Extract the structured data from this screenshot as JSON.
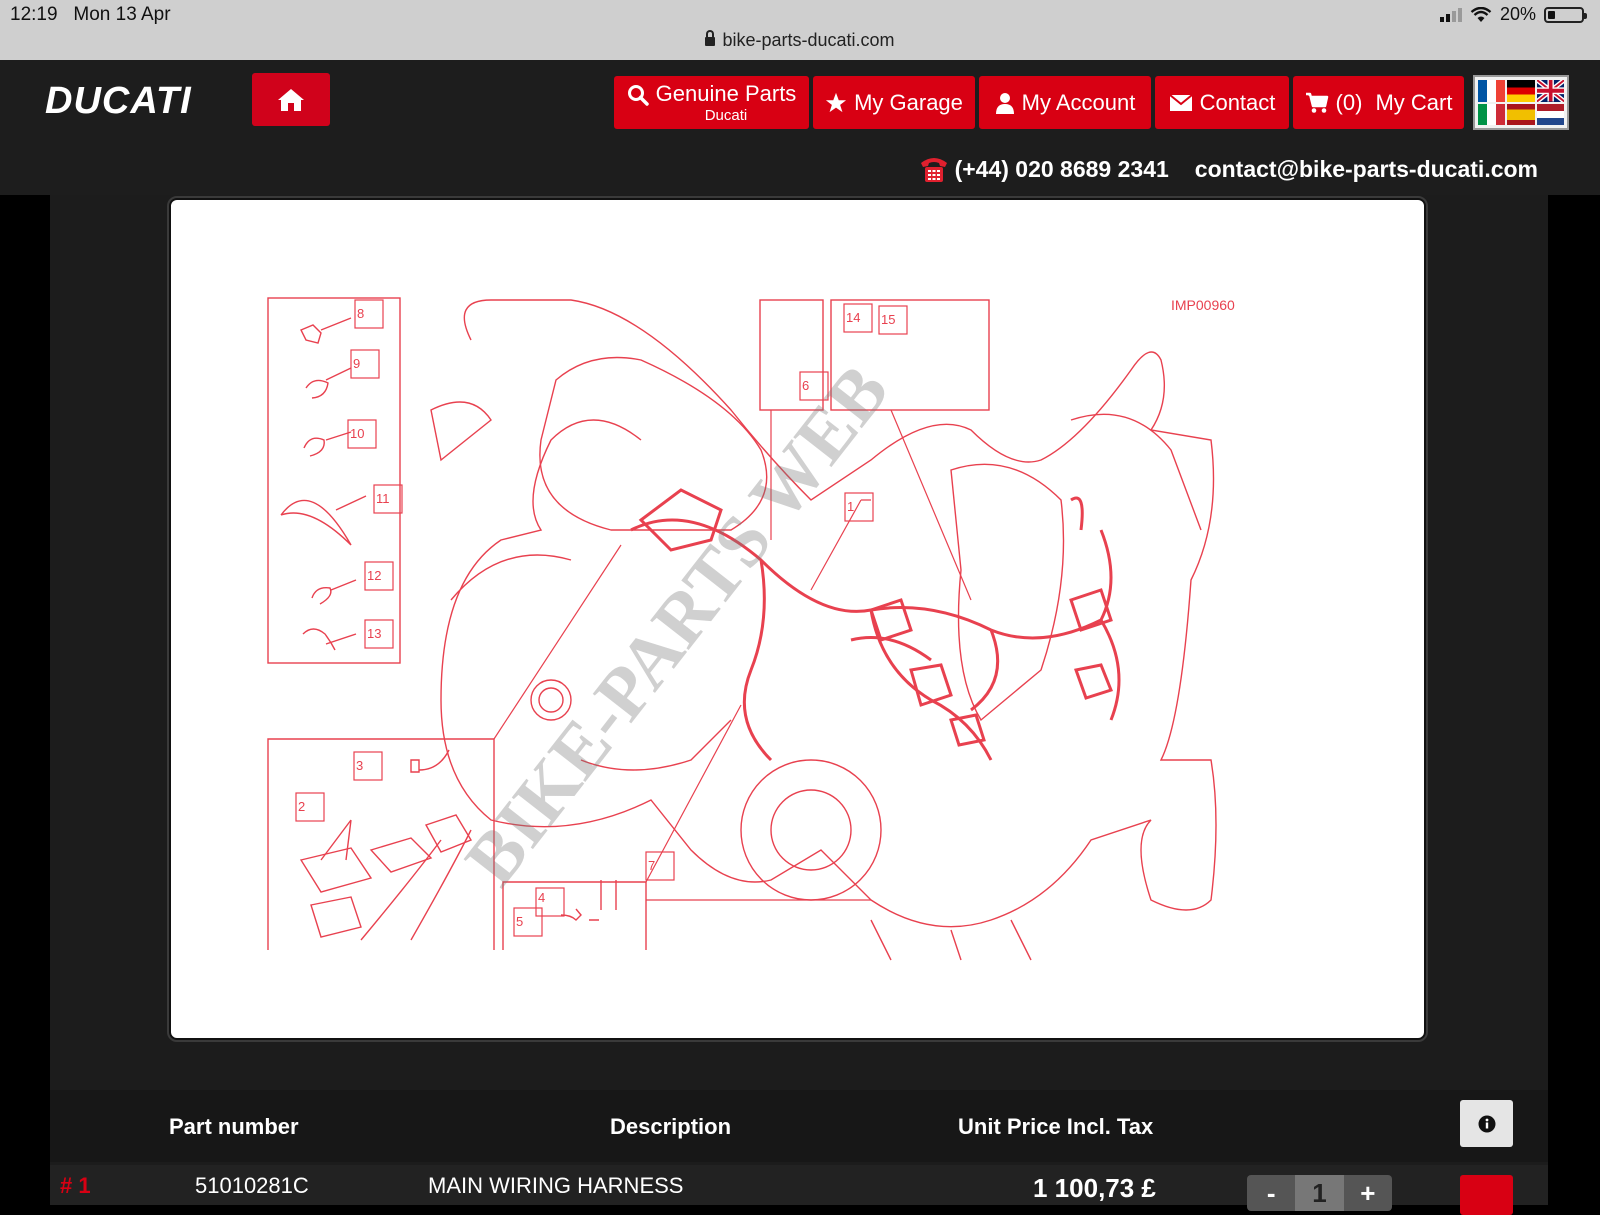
{
  "status_bar": {
    "time": "12:19",
    "date": "Mon 13 Apr",
    "battery": "20%",
    "url": "bike-parts-ducati.com"
  },
  "header": {
    "logo": "DUCATI",
    "nav": [
      {
        "label": "Genuine Parts",
        "sub": "Ducati",
        "icon": "search-icon"
      },
      {
        "label": "My Garage",
        "icon": "star-icon"
      },
      {
        "label": "My Account",
        "icon": "user-icon"
      },
      {
        "label": "Contact",
        "icon": "envelope-icon"
      },
      {
        "label": "My Cart",
        "count": "(0)",
        "icon": "cart-icon"
      }
    ],
    "phone": "(+44) 020 8689 2341",
    "email": "contact@bike-parts-ducati.com"
  },
  "diagram": {
    "ref": "IMP00960",
    "watermark": "BIKE-PARTS WEB",
    "callouts": [
      "1",
      "2",
      "3",
      "4",
      "5",
      "6",
      "7",
      "8",
      "9",
      "10",
      "11",
      "12",
      "13",
      "14",
      "15"
    ]
  },
  "table": {
    "headers": {
      "part_number": "Part number",
      "description": "Description",
      "unit_price": "Unit Price Incl. Tax"
    },
    "rows": [
      {
        "index": "# 1",
        "part_number": "51010281C",
        "description": "MAIN WIRING HARNESS",
        "price": "1 100,73 £",
        "qty": "1"
      }
    ]
  },
  "colors": {
    "brand_red": "#d80013",
    "header_bg": "#1d1d1d",
    "diagram_line": "#e8414f"
  }
}
